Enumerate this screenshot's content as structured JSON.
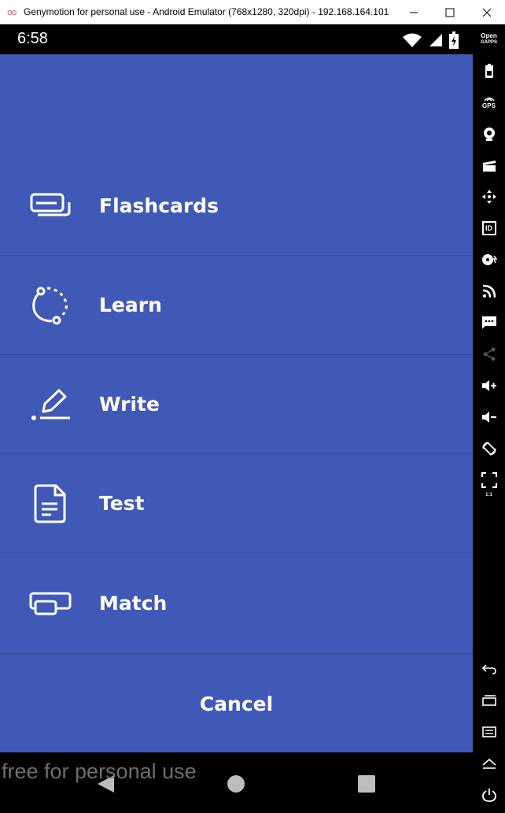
{
  "window": {
    "logo": "oo",
    "title": "Genymotion for personal use - Android Emulator (768x1280, 320dpi) - 192.168.164.101"
  },
  "statusbar": {
    "time": "6:58"
  },
  "menu": {
    "items": [
      {
        "label": "Flashcards",
        "icon": "flashcards-icon"
      },
      {
        "label": "Learn",
        "icon": "learn-icon"
      },
      {
        "label": "Write",
        "icon": "write-icon"
      },
      {
        "label": "Test",
        "icon": "test-icon"
      },
      {
        "label": "Match",
        "icon": "match-icon"
      }
    ],
    "cancel_label": "Cancel"
  },
  "watermark": "free for personal use",
  "sidebar": {
    "opengapps_label_1": "Open",
    "opengapps_label_2": "GAPPS",
    "gps_label": "GPS",
    "id_label": "ID",
    "pixel_label": "1:1"
  },
  "colors": {
    "sheet_bg": "#4159b6",
    "divider": "#3a4ea3",
    "text": "#ffffff"
  }
}
